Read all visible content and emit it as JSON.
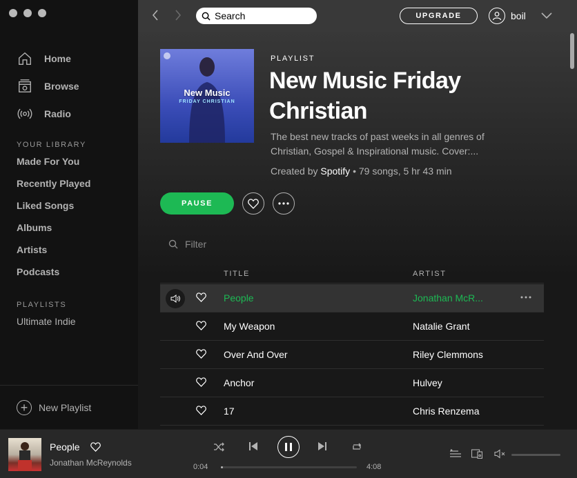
{
  "sidebar": {
    "nav": [
      {
        "label": "Home",
        "icon": "home-icon"
      },
      {
        "label": "Browse",
        "icon": "browse-icon"
      },
      {
        "label": "Radio",
        "icon": "radio-icon"
      }
    ],
    "library_title": "YOUR LIBRARY",
    "library": [
      "Made For You",
      "Recently Played",
      "Liked Songs",
      "Albums",
      "Artists",
      "Podcasts"
    ],
    "playlists_title": "PLAYLISTS",
    "playlists": [
      "Ultimate Indie"
    ],
    "new_playlist": "New Playlist"
  },
  "topbar": {
    "search_placeholder": "Search",
    "upgrade": "UPGRADE",
    "username": "boil"
  },
  "playlist": {
    "cover_title": "New Music",
    "cover_subtitle": "FRIDAY CHRISTIAN",
    "type": "PLAYLIST",
    "title": "New Music Friday Christian",
    "description": "The best new tracks of past weeks in all genres of Christian, Gospel & Inspirational music. Cover:...",
    "created_by": "Created by",
    "owner": "Spotify",
    "stats": " • 79 songs, 5 hr 43 min",
    "pause_label": "PAUSE",
    "filter_placeholder": "Filter",
    "columns": {
      "title": "TITLE",
      "artist": "ARTIST"
    },
    "tracks": [
      {
        "title": "People",
        "artist": "Jonathan McR...",
        "playing": true
      },
      {
        "title": "My Weapon",
        "artist": "Natalie Grant",
        "playing": false
      },
      {
        "title": "Over And Over",
        "artist": "Riley Clemmons",
        "playing": false
      },
      {
        "title": "Anchor",
        "artist": "Hulvey",
        "playing": false
      },
      {
        "title": "17",
        "artist": "Chris Renzema",
        "playing": false
      }
    ]
  },
  "player": {
    "title": "People",
    "artist": "Jonathan McReynolds",
    "elapsed": "0:04",
    "duration": "4:08",
    "progress_fraction": 0.016,
    "volume_fraction": 0,
    "muted": true
  },
  "colors": {
    "accent": "#1db954",
    "sidebar_bg": "#121212",
    "player_bg": "#282828"
  }
}
